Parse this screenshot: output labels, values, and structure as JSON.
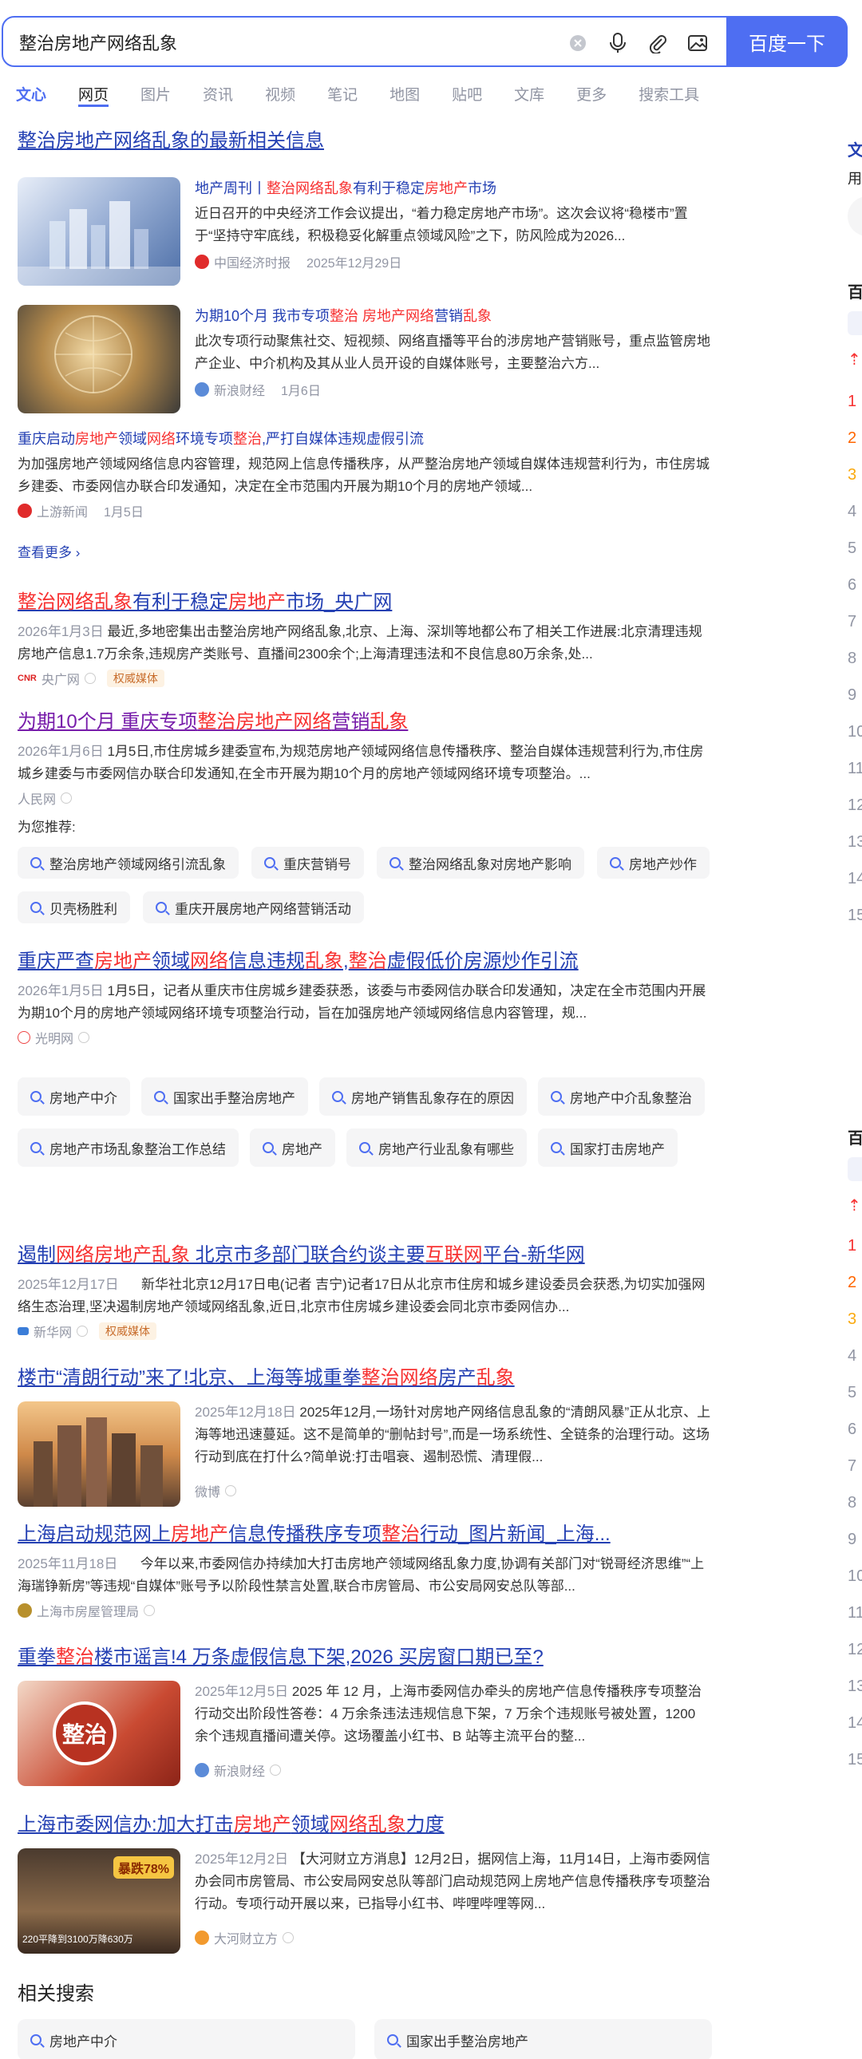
{
  "search": {
    "query": "整治房地产网络乱象",
    "button": "百度一下"
  },
  "tabs": [
    "文心",
    "网页",
    "图片",
    "资讯",
    "视频",
    "笔记",
    "地图",
    "贴吧",
    "文库",
    "更多",
    "搜索工具"
  ],
  "latest": {
    "header": "整治房地产网络乱象的最新相关信息",
    "items": [
      {
        "title": "地产周刊丨整治网络乱象有利于稳定房地产市场",
        "abstract": "近日召开的中央经济工作会议提出，“着力稳定房地产市场”。这次会议将“稳楼市”置于“坚持守牢底线，积极稳妥化解重点领域风险”之下，防风险成为2026...",
        "source": "中国经济时报",
        "date": "2025年12月29日"
      },
      {
        "title": "为期10个月 我市专项整治 房地产网络营销乱象",
        "abstract": "此次专项行动聚焦社交、短视频、网络直播等平台的涉房地产营销账号，重点监管房地产企业、中介机构及其从业人员开设的自媒体账号，主要整治六方...",
        "source": "新浪财经",
        "date": "1月6日"
      },
      {
        "title": "重庆启动房地产领域网络环境专项整治,严打自媒体违规虚假引流",
        "abstract": "为加强房地产领域网络信息内容管理，规范网上信息传播秩序，从严整治房地产领域自媒体违规营利行为，市住房城乡建委、市委网信办联合印发通知，决定在全市范围内开展为期10个月的房地产领域...",
        "source": "上游新闻",
        "date": "1月5日"
      }
    ],
    "more": "查看更多 ›"
  },
  "results": [
    {
      "title": "整治网络乱象有利于稳定房地产市场_央广网",
      "date": "2026年1月3日",
      "abstract": "最近,多地密集出击整治房地产网络乱象,北京、上海、深圳等地都公布了相关工作进展:北京清理违规房地产信息1.7万余条,违规房产类账号、直播间2300余个;上海清理违法和不良信息80万余条,处...",
      "source": "央广网",
      "badge": "权威媒体"
    },
    {
      "title": "为期10个月 重庆专项整治房地产网络营销乱象",
      "date": "2026年1月6日",
      "abstract": "1月5日,市住房城乡建委宣布,为规范房地产领域网络信息传播秩序、整治自媒体违规营利行为,市住房城乡建委与市委网信办联合印发通知,在全市开展为期10个月的房地产领域网络环境专项整治。...",
      "source": "人民网"
    },
    {
      "title": "重庆严查房地产领域网络信息违规乱象,整治虚假低价房源炒作引流",
      "date": "2026年1月5日",
      "abstract": "1月5日，记者从重庆市住房城乡建委获悉，该委与市委网信办联合印发通知，决定在全市范围内开展为期10个月的房地产领域网络环境专项整治行动，旨在加强房地产领域网络信息内容管理，规...",
      "source": "光明网"
    },
    {
      "title": "遏制网络房地产乱象 北京市多部门联合约谈主要互联网平台-新华网",
      "date": "2025年12月17日",
      "abstract": "新华社北京12月17日电(记者 吉宁)记者17日从北京市住房和城乡建设委员会获悉,为切实加强网络生态治理,坚决遏制房地产领域网络乱象,近日,北京市住房城乡建设委会同北京市委网信办...",
      "source": "新华网",
      "badge": "权威媒体"
    },
    {
      "title": "楼市“清朗行动”来了!北京、上海等城重拳整治网络房产乱象",
      "date": "2025年12月18日",
      "abstract": "2025年12月,一场针对房地产网络信息乱象的“清朗风暴”正从北京、上海等地迅速蔓延。这不是简单的“删帖封号”,而是一场系统性、全链条的治理行动。这场行动到底在打什么?简单说:打击唱衰、遏制恐慌、清理假...",
      "source": "微博"
    },
    {
      "title": "上海启动规范网上房地产信息传播秩序专项整治行动_图片新闻_上海...",
      "date": "2025年11月18日",
      "abstract": "今年以来,市委网信办持续加大打击房地产领域网络乱象力度,协调有关部门对“锐哥经济思维”“上海瑞铮新房”等违规“自媒体”账号予以阶段性禁言处置,联合市房管局、市公安局网安总队等部...",
      "source": "上海市房屋管理局"
    },
    {
      "title": "重拳整治楼市谣言!4 万条虚假信息下架,2026 买房窗口期已至?",
      "date": "2025年12月5日",
      "abstract": "2025 年 12 月，上海市委网信办牵头的房地产信息传播秩序专项整治行动交出阶段性答卷：4 万余条违法违规信息下架，7 万余个违规账号被处置，1200 余个违规直播间遭关停。这场覆盖小红书、B 站等主流平台的整...",
      "source": "新浪财经",
      "thumb_text": "整治"
    },
    {
      "title": "上海市委网信办:加大打击房地产领域网络乱象力度",
      "date": "2025年12月2日",
      "abstract": "【大河财立方消息】12月2日，据网信上海，11月14日，上海市委网信办会同市房管局、市公安局网安总队等部门启动规范网上房地产信息传播秩序专项整治行动。专项行动开展以来，已指导小红书、哔哩哔哩等网...",
      "source": "大河财立方",
      "thumb_badge": "暴跌78%",
      "thumb_caption": "220平降到3100万降630万"
    }
  ],
  "recommend": {
    "label": "为您推荐:",
    "chips": [
      "整治房地产领域网络引流乱象",
      "重庆营销号",
      "整治网络乱象对房地产影响",
      "房地产炒作",
      "贝壳杨胜利",
      "重庆开展房地产网络营销活动"
    ]
  },
  "chips2": [
    "房地产中介",
    "国家出手整治房地产",
    "房地产销售乱象存在的原因",
    "房地产中介乱象整治",
    "房地产市场乱象整治工作总结",
    "房地产",
    "房地产行业乱象有哪些",
    "国家打击房地产"
  ],
  "related": {
    "header": "相关搜索",
    "chips": [
      "房地产中介",
      "国家出手整治房地产"
    ]
  },
  "right": {
    "head1": "文",
    "head1b": "用",
    "head2": "百",
    "head3": "百",
    "nums": [
      "1",
      "2",
      "3",
      "4",
      "5",
      "6",
      "7",
      "8",
      "9",
      "10",
      "11",
      "12",
      "13",
      "14",
      "15"
    ]
  },
  "colors": {
    "accent": "#4e6ef2",
    "link": "#2440b3",
    "highlight": "#f73131",
    "muted": "#9195a3"
  }
}
